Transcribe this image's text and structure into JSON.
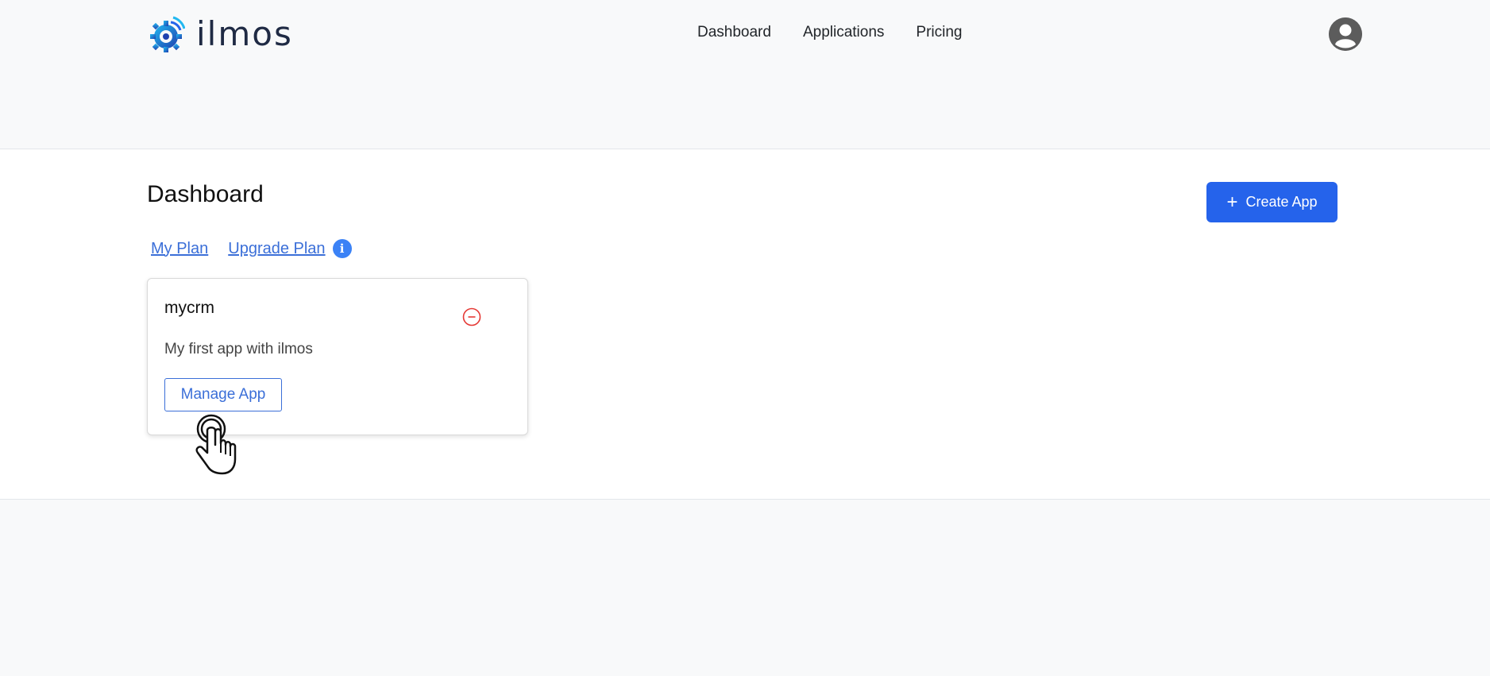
{
  "header": {
    "logo_text": "ilmos",
    "nav": [
      {
        "label": "Dashboard"
      },
      {
        "label": "Applications"
      },
      {
        "label": "Pricing"
      }
    ]
  },
  "main": {
    "title": "Dashboard",
    "create_button": "Create App",
    "plan_links": {
      "my_plan": "My Plan",
      "upgrade_plan": "Upgrade Plan"
    },
    "apps": [
      {
        "name": "mycrm",
        "description": "My first app with ilmos",
        "manage_label": "Manage App"
      }
    ]
  },
  "colors": {
    "primary": "#2563eb",
    "link": "#3b6fd8",
    "danger": "#e53935",
    "page_bg": "#f8f9fa"
  },
  "icons": [
    "logo-gear-icon",
    "user-avatar-icon",
    "plus-icon",
    "info-icon",
    "remove-circle-icon",
    "hand-pointer-cursor-icon"
  ]
}
